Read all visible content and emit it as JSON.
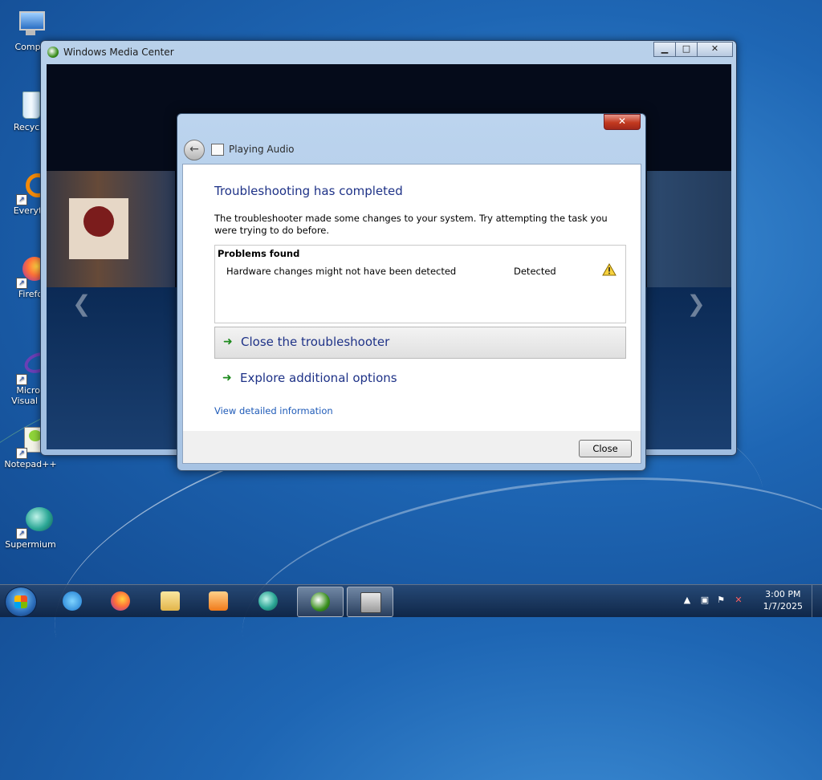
{
  "desktop": {
    "icons": [
      {
        "label": "Compu",
        "icon": "computer-icon"
      },
      {
        "label": "Recycle",
        "icon": "recycle-bin-icon"
      },
      {
        "label": "Everyth",
        "icon": "everything-icon"
      },
      {
        "label": "Firefo",
        "icon": "firefox-icon"
      },
      {
        "label": "Micros\nVisual St",
        "icon": "visual-studio-icon"
      },
      {
        "label": "Notepad++",
        "icon": "notepad-plus-plus-icon"
      },
      {
        "label": "Supermium",
        "icon": "supermium-icon"
      }
    ]
  },
  "wmc_window": {
    "title": "Windows Media Center",
    "buttons": {
      "minimize": "▁",
      "maximize": "□",
      "close": "✕"
    }
  },
  "dialog": {
    "title": "Playing Audio",
    "heading": "Troubleshooting has completed",
    "description": "The troubleshooter made some changes to your system. Try attempting the task you were trying to do before.",
    "problems_header": "Problems found",
    "problems": [
      {
        "description": "Hardware changes might not have been detected",
        "status": "Detected",
        "icon": "warning-icon"
      }
    ],
    "actions": [
      {
        "label": "Close the troubleshooter",
        "icon": "green-arrow-icon"
      },
      {
        "label": "Explore additional options",
        "icon": "green-arrow-icon"
      }
    ],
    "detail_link": "View detailed information",
    "close_button": "Close",
    "titlebar_close": "✕"
  },
  "taskbar": {
    "items": [
      "start-button",
      "internet-explorer-icon",
      "firefox-icon",
      "file-explorer-icon",
      "media-player-icon",
      "supermium-icon",
      "windows-media-center-icon",
      "troubleshooter-icon"
    ],
    "active_items": [
      "windows-media-center-icon",
      "troubleshooter-icon"
    ],
    "clock_time": "3:00 PM",
    "clock_date": "1/7/2025"
  }
}
